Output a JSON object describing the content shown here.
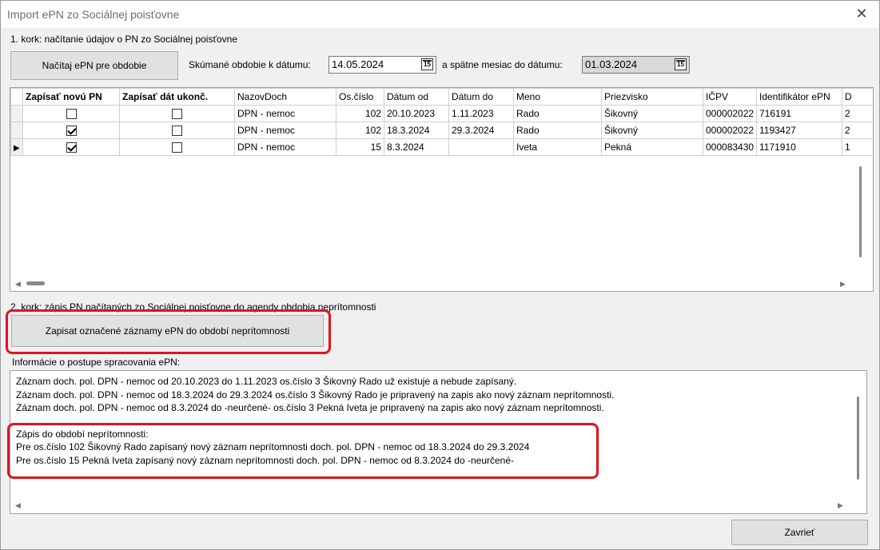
{
  "window": {
    "title": "Import ePN zo Sociálnej poisťovne",
    "close_glyph": "✕"
  },
  "step1": {
    "label": "1. kork: načítanie údajov o PN zo Sociálnej poisťovne",
    "load_button": "Načítaj ePN pre obdobie",
    "date_label": "Skúmané obdobie k dátumu:",
    "date_value": "14.05.2024",
    "back_label": "a spätne mesiac do dátumu:",
    "back_value": "01.03.2024",
    "calendar_glyph": "15"
  },
  "grid": {
    "columns": [
      "Zapísať novú PN",
      "Zapísať dát ukonč.",
      "NazovDoch",
      "Os.číslo",
      "Dátum od",
      "Dátum do",
      "Meno",
      "Priezvisko",
      "IČPV",
      "Identifikátor ePN",
      "D"
    ],
    "rows": [
      {
        "current": false,
        "new_pn": false,
        "end_date": false,
        "nazov": "DPN - nemoc",
        "os": "102",
        "od": "20.10.2023",
        "do": "1.11.2023",
        "meno": "Rado",
        "priezvisko": "Šikovný",
        "icpv": "000002022",
        "epn": "716191",
        "d": "2"
      },
      {
        "current": false,
        "new_pn": true,
        "end_date": false,
        "nazov": "DPN - nemoc",
        "os": "102",
        "od": "18.3.2024",
        "do": "29.3.2024",
        "meno": "Rado",
        "priezvisko": "Šikovný",
        "icpv": "000002022",
        "epn": "1193427",
        "d": "2"
      },
      {
        "current": true,
        "new_pn": true,
        "end_date": false,
        "nazov": "DPN - nemoc",
        "os": "15",
        "od": "8.3.2024",
        "do": "",
        "meno": "Iveta",
        "priezvisko": "Pekná",
        "icpv": "000083430",
        "epn": "1171910",
        "d": "1"
      }
    ]
  },
  "step2": {
    "label": "2. kork: zápis PN načítaných zo Sociálnej poisťovne do agendy obdobia neprítomnosti",
    "write_button": "Zapisat označené záznamy ePN do období neprítomnosti"
  },
  "info": {
    "label": "Informácie o postupe spracovania ePN:",
    "lines": [
      "Záznam doch. pol. DPN - nemoc od 20.10.2023 do 1.11.2023 os.číslo 3 Šikovný Rado už existuje a nebude zapísaný.",
      "Záznam doch. pol. DPN - nemoc od 18.3.2024 do 29.3.2024 os.číslo 3 Šikovný Rado je pripravený na zapis ako nový záznam neprítomnosti.",
      "Záznam doch. pol. DPN - nemoc od 8.3.2024 do -neurčené- os.číslo 3 Pekná Iveta je pripravený na zapis ako nový záznam neprítomnosti."
    ],
    "result_lines": [
      "Zápis do období neprítomnosti:",
      "Pre os.číslo 102 Šikovný Rado zapísaný nový záznam neprítomnosti doch. pol. DPN - nemoc od 18.3.2024 do 29.3.2024",
      "Pre os.číslo 15 Pekná Iveta zapísaný nový záznam neprítomnosti doch. pol. DPN - nemoc od 8.3.2024 do -neurčené-"
    ]
  },
  "close_button": "Zavrieť",
  "colors": {
    "highlight": "#e0141e",
    "window_bg": "#f0f0f0",
    "button_bg": "#e1e1e1"
  }
}
